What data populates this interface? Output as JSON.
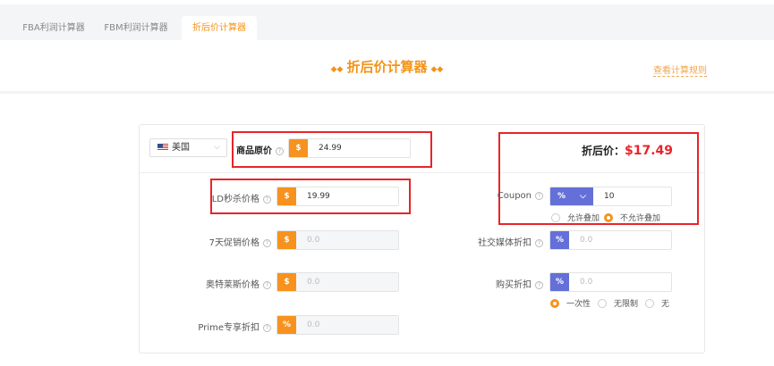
{
  "tabs": [
    {
      "label": "FBA利润计算器"
    },
    {
      "label": "FBM利润计算器"
    },
    {
      "label": "折后价计算器"
    }
  ],
  "title": "折后价计算器",
  "rules_link": "查看计算规则",
  "country": "美国",
  "left": [
    {
      "label": "商品原价",
      "prefix": "$",
      "value": "24.99"
    },
    {
      "label": "LD秒杀价格",
      "prefix": "$",
      "value": "19.99"
    },
    {
      "label": "7天促销价格",
      "prefix": "$",
      "value": "0.0"
    },
    {
      "label": "奥特莱斯价格",
      "prefix": "$",
      "value": "0.0"
    },
    {
      "label": "Prime专享折扣",
      "prefix": "%",
      "value": "0.0"
    }
  ],
  "result": {
    "label": "折后价：",
    "value": "$17.49"
  },
  "coupon": {
    "label": "Coupon",
    "unit": "%",
    "value": "10",
    "options": [
      "允许叠加",
      "不允许叠加"
    ],
    "selected": 1
  },
  "social": {
    "label": "社交媒体折扣",
    "prefix": "%",
    "value": "0.0"
  },
  "purchase": {
    "label": "购买折扣",
    "prefix": "%",
    "value": "0.0",
    "options": [
      "一次性",
      "无限制",
      "无"
    ],
    "selected": 0
  },
  "colors": {
    "accent": "#f7921e",
    "purple": "#6470d8",
    "red": "#e8242b"
  }
}
